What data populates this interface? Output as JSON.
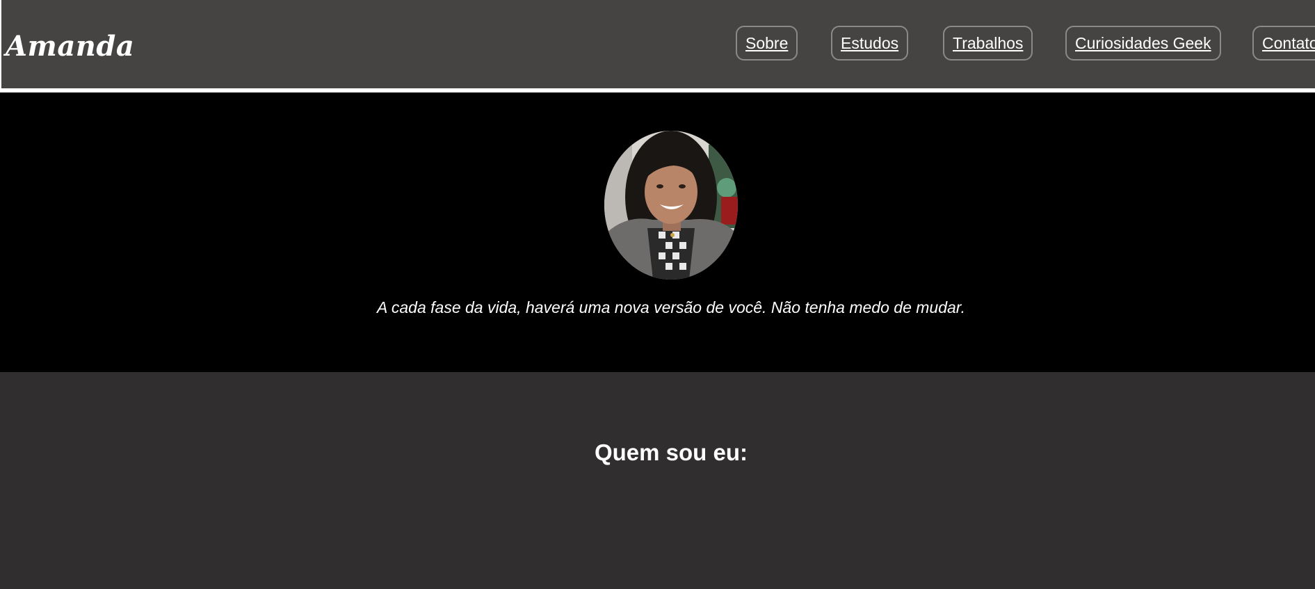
{
  "header": {
    "brand": "Amanda",
    "nav": [
      {
        "label": "Sobre"
      },
      {
        "label": "Estudos"
      },
      {
        "label": "Trabalhos"
      },
      {
        "label": "Curiosidades Geek"
      },
      {
        "label": "Contato"
      }
    ]
  },
  "hero": {
    "avatar_icon": "profile-photo",
    "quote": "A cada fase da vida, haverá uma nova versão de você. Não tenha medo de mudar."
  },
  "about": {
    "title": "Quem sou eu:"
  },
  "colors": {
    "header_bg": "#464443",
    "hero_bg": "#000000",
    "section_bg": "#302e2f",
    "text": "#ffffff",
    "nav_border": "#8c8a89"
  }
}
